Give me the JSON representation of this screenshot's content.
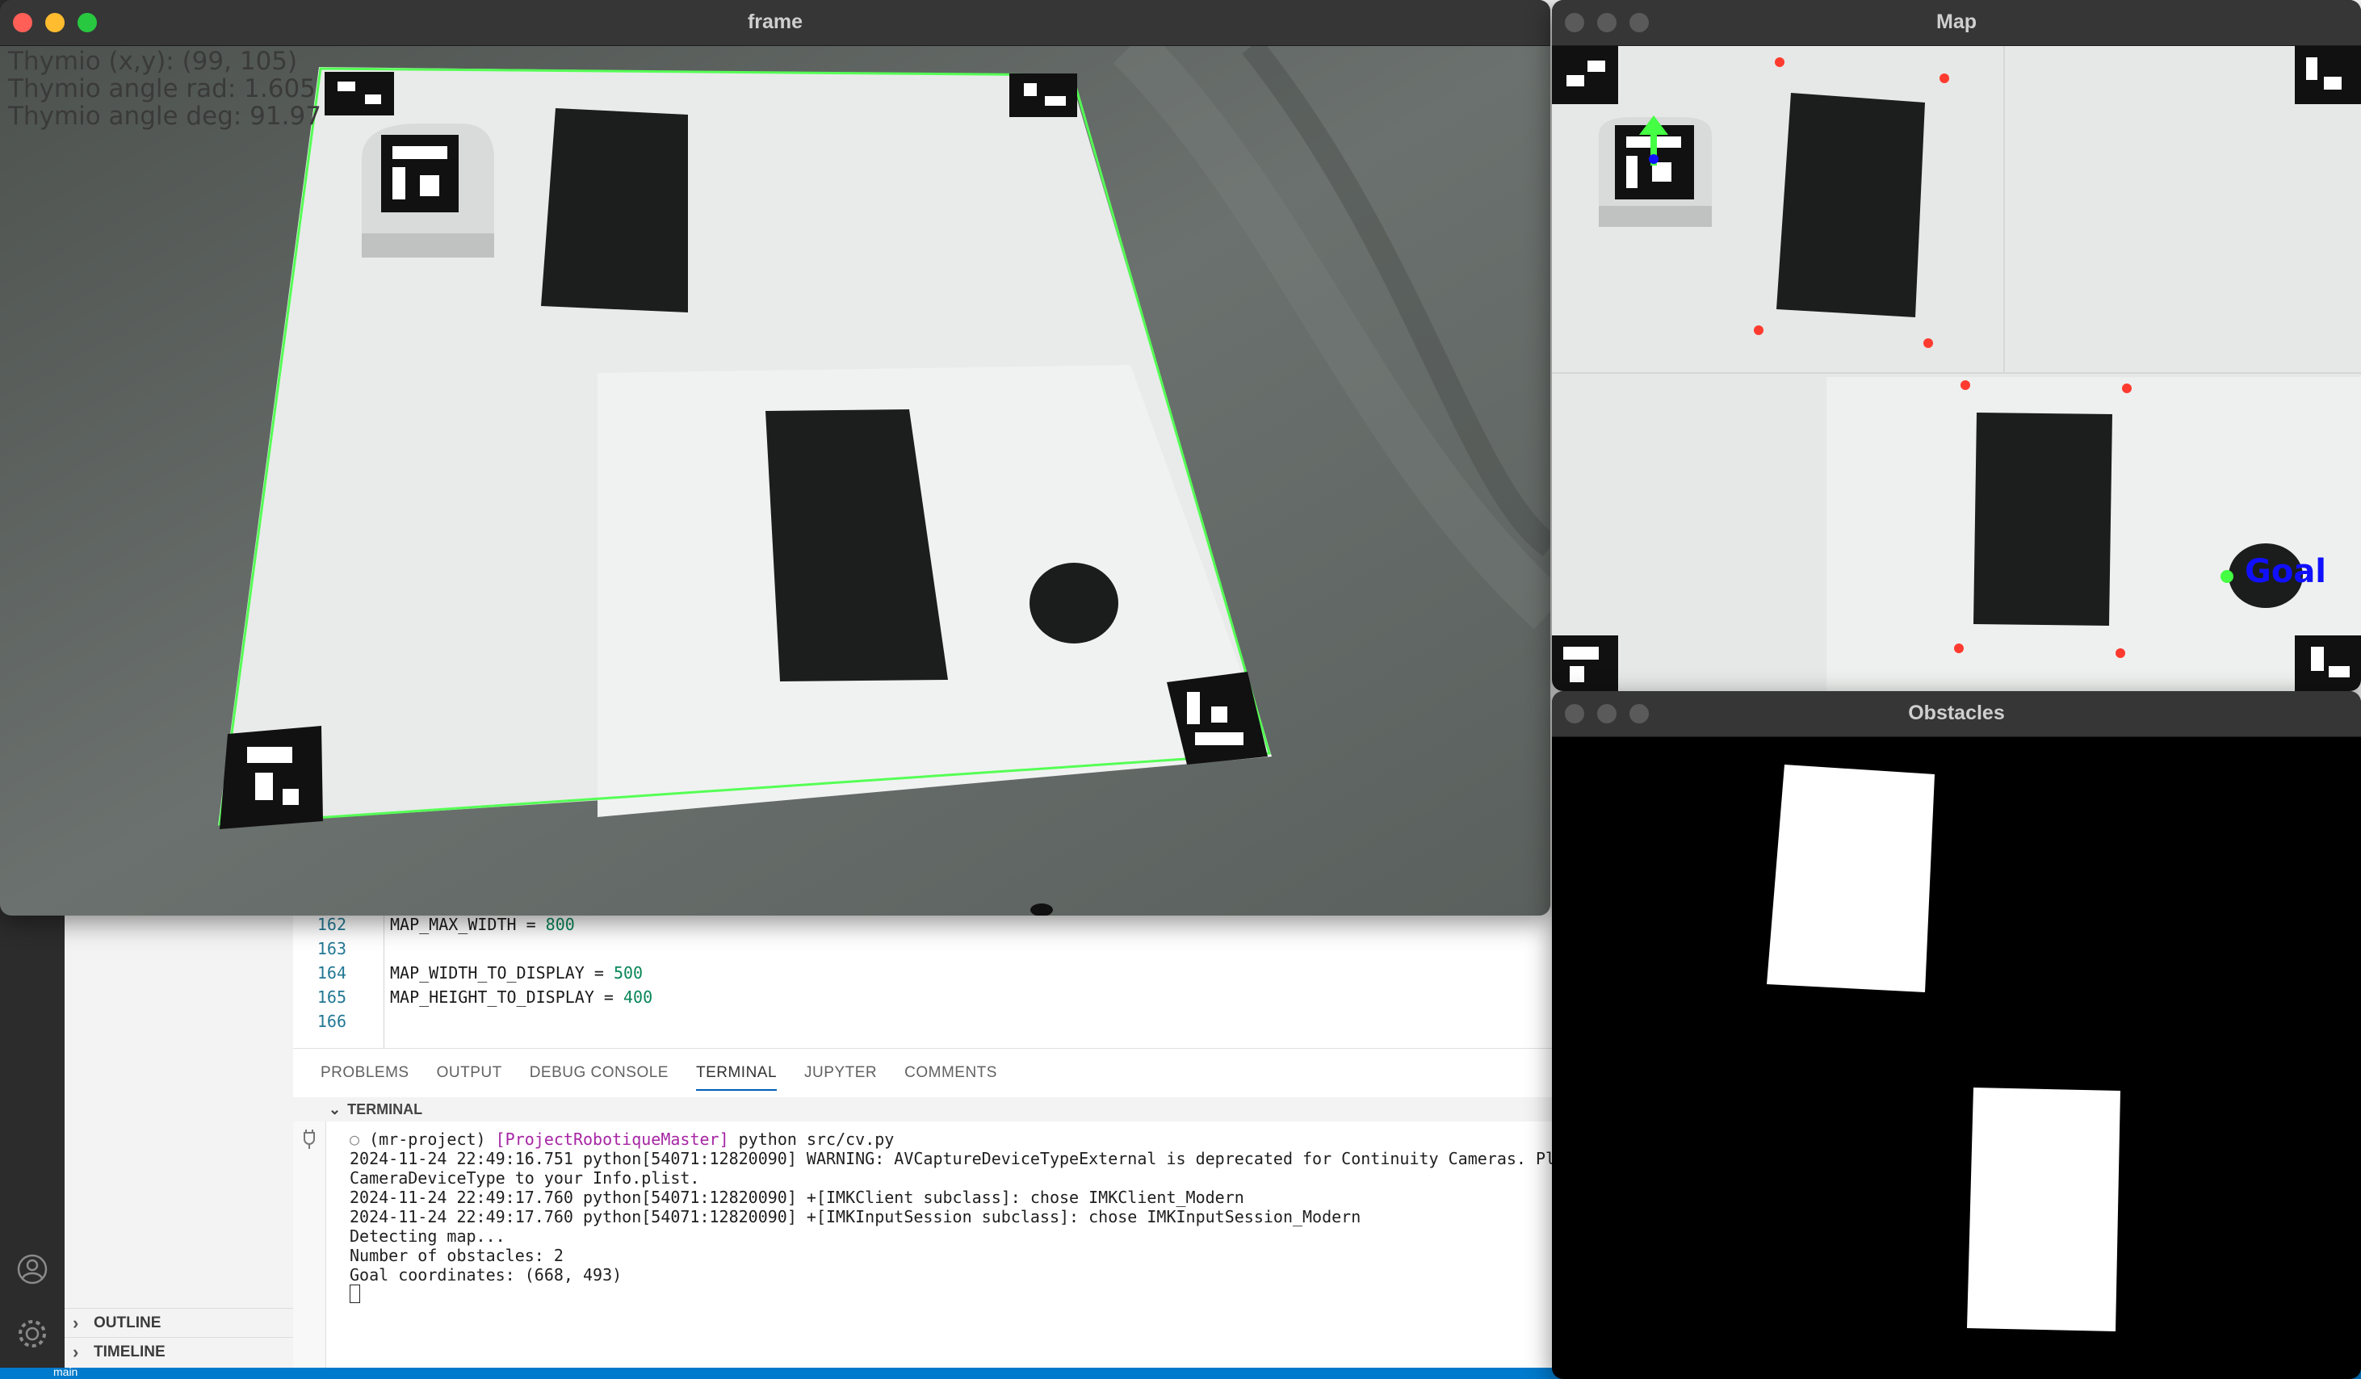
{
  "windows": {
    "frame": {
      "title": "frame",
      "overlay_lines": [
        "Thymio (x,y): (99, 105)",
        "Thymio angle rad: 1.605",
        "Thymio angle deg: 91.97"
      ]
    },
    "map": {
      "title": "Map",
      "goal_label": "Goal"
    },
    "obstacles": {
      "title": "Obstacles"
    }
  },
  "editor": {
    "lines": [
      {
        "num": "162",
        "code": "MAP_MAX_WIDTH = ",
        "value": "800"
      },
      {
        "num": "163",
        "code": "",
        "value": ""
      },
      {
        "num": "164",
        "code": "MAP_WIDTH_TO_DISPLAY = ",
        "value": "500"
      },
      {
        "num": "165",
        "code": "MAP_HEIGHT_TO_DISPLAY = ",
        "value": "400"
      },
      {
        "num": "166",
        "code": "",
        "value": ""
      }
    ]
  },
  "panel": {
    "tabs": [
      "PROBLEMS",
      "OUTPUT",
      "DEBUG CONSOLE",
      "TERMINAL",
      "JUPYTER",
      "COMMENTS"
    ],
    "active_tab": "TERMINAL",
    "section_title": "TERMINAL"
  },
  "terminal": {
    "prompt_env": "(mr-project) ",
    "prompt_dir": "[ProjectRobotiqueMaster]",
    "command": " python src/cv.py",
    "output": [
      "2024-11-24 22:49:16.751 python[54071:12820090] WARNING: AVCaptureDeviceTypeExternal is deprecated for Continuity Cameras. Pl",
      "CameraDeviceType to your Info.plist.",
      "2024-11-24 22:49:17.760 python[54071:12820090] +[IMKClient subclass]: chose IMKClient_Modern",
      "2024-11-24 22:49:17.760 python[54071:12820090] +[IMKInputSession subclass]: chose IMKInputSession_Modern",
      "Detecting map...",
      "Number of obstacles: 2",
      "Goal coordinates: (668, 493)"
    ]
  },
  "sidebar": {
    "outline_label": "OUTLINE",
    "timeline_label": "TIMELINE"
  },
  "statusbar": {
    "branch_label": "main"
  },
  "colors": {
    "traffic_red": "#ff5f57",
    "traffic_yellow": "#febc2e",
    "traffic_green": "#28c840",
    "inactive_dot": "#5a5a5a",
    "boundary_green": "#55ff55",
    "obstacle_corner_red": "#ff3b2f",
    "goal_blue": "#1010ff",
    "status_blue": "#007acc"
  },
  "icons": [
    "account-icon",
    "gear-icon",
    "chevron-right-icon",
    "chevron-down-icon",
    "arrow-up-icon"
  ]
}
